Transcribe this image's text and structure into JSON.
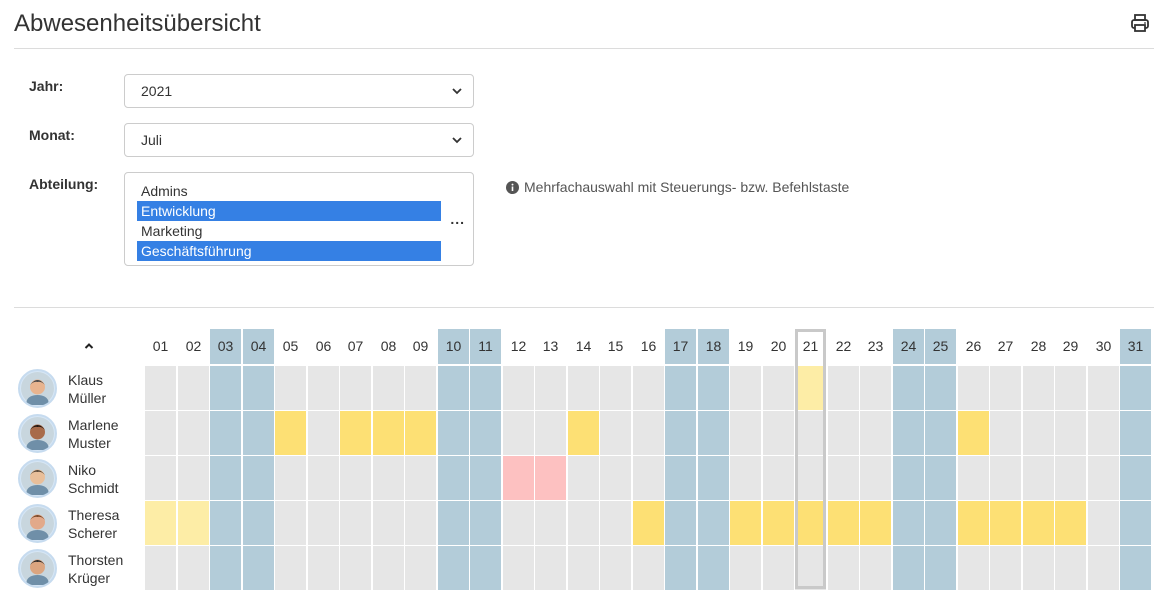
{
  "header": {
    "title": "Abwesenheitsübersicht",
    "print_icon": "printer-icon"
  },
  "filters": {
    "year_label": "Jahr:",
    "year_value": "2021",
    "month_label": "Monat:",
    "month_value": "Juli",
    "department_label": "Abteilung:",
    "departments": [
      {
        "label": "Admins",
        "selected": false
      },
      {
        "label": "Entwicklung",
        "selected": true
      },
      {
        "label": "Marketing",
        "selected": false
      },
      {
        "label": "Geschäftsführung",
        "selected": true
      }
    ],
    "more_label": "...",
    "hint": "Mehrfachauswahl mit Steuerungs- bzw. Befehlstaste",
    "hint_icon": "info-icon"
  },
  "calendar": {
    "days": [
      "01",
      "02",
      "03",
      "04",
      "05",
      "06",
      "07",
      "08",
      "09",
      "10",
      "11",
      "12",
      "13",
      "14",
      "15",
      "16",
      "17",
      "18",
      "19",
      "20",
      "21",
      "22",
      "23",
      "24",
      "25",
      "26",
      "27",
      "28",
      "29",
      "30",
      "31"
    ],
    "weekend_days": [
      "03",
      "04",
      "10",
      "11",
      "17",
      "18",
      "24",
      "25",
      "31"
    ],
    "today": "21",
    "collapse_icon": "chevron-up-icon",
    "people": [
      {
        "first": "Klaus",
        "last": "Müller",
        "absences": {
          "21": "light"
        }
      },
      {
        "first": "Marlene",
        "last": "Muster",
        "absences": {
          "05": "vacation",
          "07": "vacation",
          "08": "vacation",
          "09": "vacation",
          "14": "vacation",
          "26": "vacation"
        }
      },
      {
        "first": "Niko",
        "last": "Schmidt",
        "absences": {
          "12": "sick",
          "13": "sick"
        }
      },
      {
        "first": "Theresa",
        "last": "Scherer",
        "absences": {
          "01": "light",
          "02": "light",
          "16": "vacation",
          "19": "vacation",
          "20": "vacation",
          "21": "vacation",
          "22": "vacation",
          "23": "vacation",
          "26": "vacation",
          "27": "vacation",
          "28": "vacation",
          "29": "vacation"
        }
      },
      {
        "first": "Thorsten",
        "last": "Krüger",
        "absences": {}
      }
    ],
    "colors": {
      "weekend": "#b3ccd9",
      "workday": "#e6e6e6",
      "vacation": "#fde074",
      "vacation_light": "#fdeda6",
      "sick": "#fdc1c1"
    }
  }
}
